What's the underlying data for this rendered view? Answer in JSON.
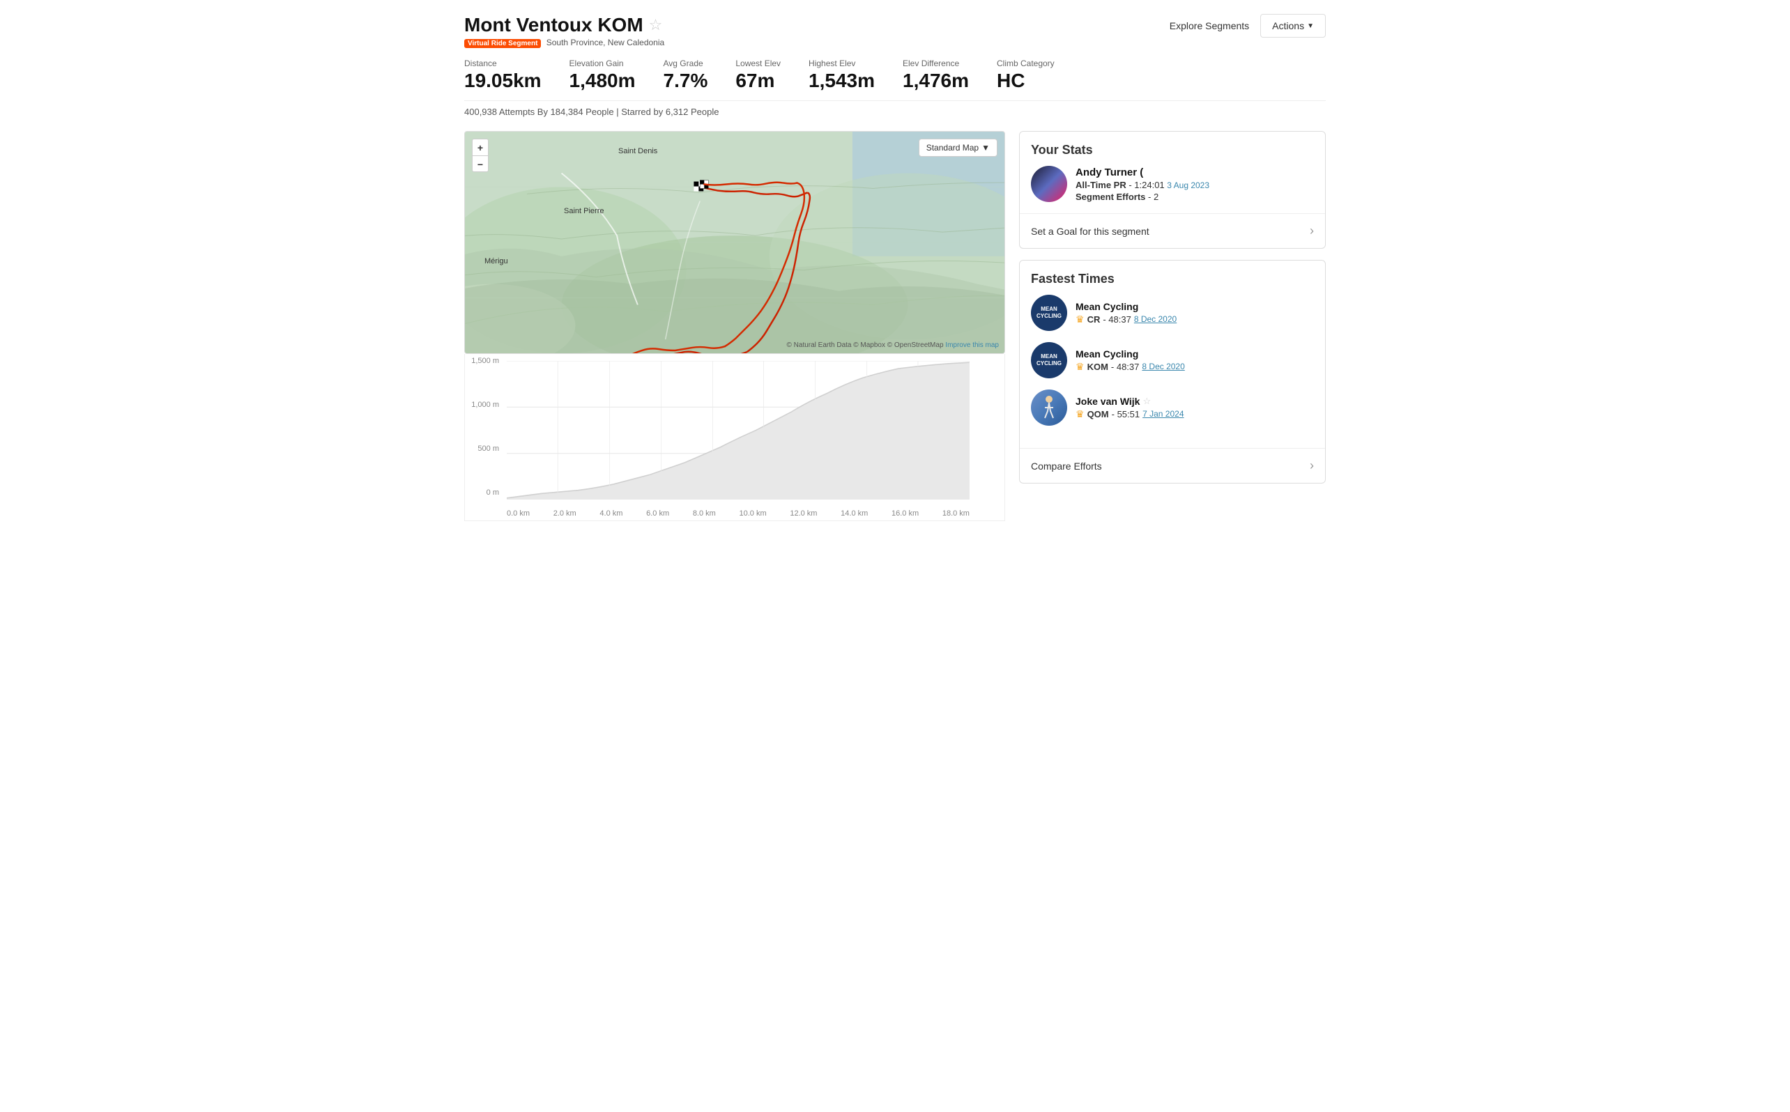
{
  "header": {
    "title": "Mont Ventoux KOM",
    "star": "☆",
    "subtitle_badge": "Virtual Ride Segment",
    "subtitle_location": "South Province, New Caledonia",
    "explore_label": "Explore Segments",
    "actions_label": "Actions",
    "actions_chevron": "▼"
  },
  "stats": [
    {
      "label": "Distance",
      "value": "19.05km"
    },
    {
      "label": "Elevation Gain",
      "value": "1,480m"
    },
    {
      "label": "Avg Grade",
      "value": "7.7%"
    },
    {
      "label": "Lowest Elev",
      "value": "67m"
    },
    {
      "label": "Highest Elev",
      "value": "1,543m"
    },
    {
      "label": "Elev Difference",
      "value": "1,476m"
    },
    {
      "label": "Climb Category",
      "value": "HC"
    }
  ],
  "attempts_text": "400,938 Attempts By 184,384 People | Starred by 6,312 People",
  "map": {
    "zoom_plus": "+",
    "zoom_minus": "−",
    "map_type": "Standard Map",
    "attribution": "© Natural Earth Data © Mapbox © OpenStreetMap",
    "improve": "Improve this map",
    "saint_denis": "Saint Denis",
    "saint_pierre": "Saint Pierre",
    "merigu": "Mérigu"
  },
  "elevation": {
    "y_ticks": [
      "1,500 m",
      "1,000 m",
      "500 m",
      "0 m"
    ],
    "x_ticks": [
      "0.0 km",
      "2.0 km",
      "4.0 km",
      "6.0 km",
      "8.0 km",
      "10.0 km",
      "12.0 km",
      "14.0 km",
      "16.0 km",
      "18.0 km"
    ]
  },
  "your_stats": {
    "title": "Your Stats",
    "user_name": "Andy Turner (",
    "pr_label": "All-Time PR",
    "pr_value": "- 1:24:01",
    "pr_date": "3 Aug 2023",
    "efforts_label": "Segment Efforts",
    "efforts_value": "- 2",
    "goal_label": "Set a Goal for this segment"
  },
  "fastest_times": {
    "title": "Fastest Times",
    "entries": [
      {
        "name": "Mean Cycling",
        "badge": "CR",
        "time": "- 48:37",
        "date": "8 Dec 2020",
        "avatar_text": "MEAN\nCYCLING"
      },
      {
        "name": "Mean Cycling",
        "badge": "KOM",
        "time": "- 48:37",
        "date": "8 Dec 2020",
        "avatar_text": "MEAN\nCYCLING"
      },
      {
        "name": "Joke van Wijk",
        "star": "☆",
        "badge": "QOM",
        "time": "- 55:51",
        "date": "7 Jan 2024",
        "avatar_text": ""
      }
    ],
    "compare_label": "Compare Efforts"
  }
}
